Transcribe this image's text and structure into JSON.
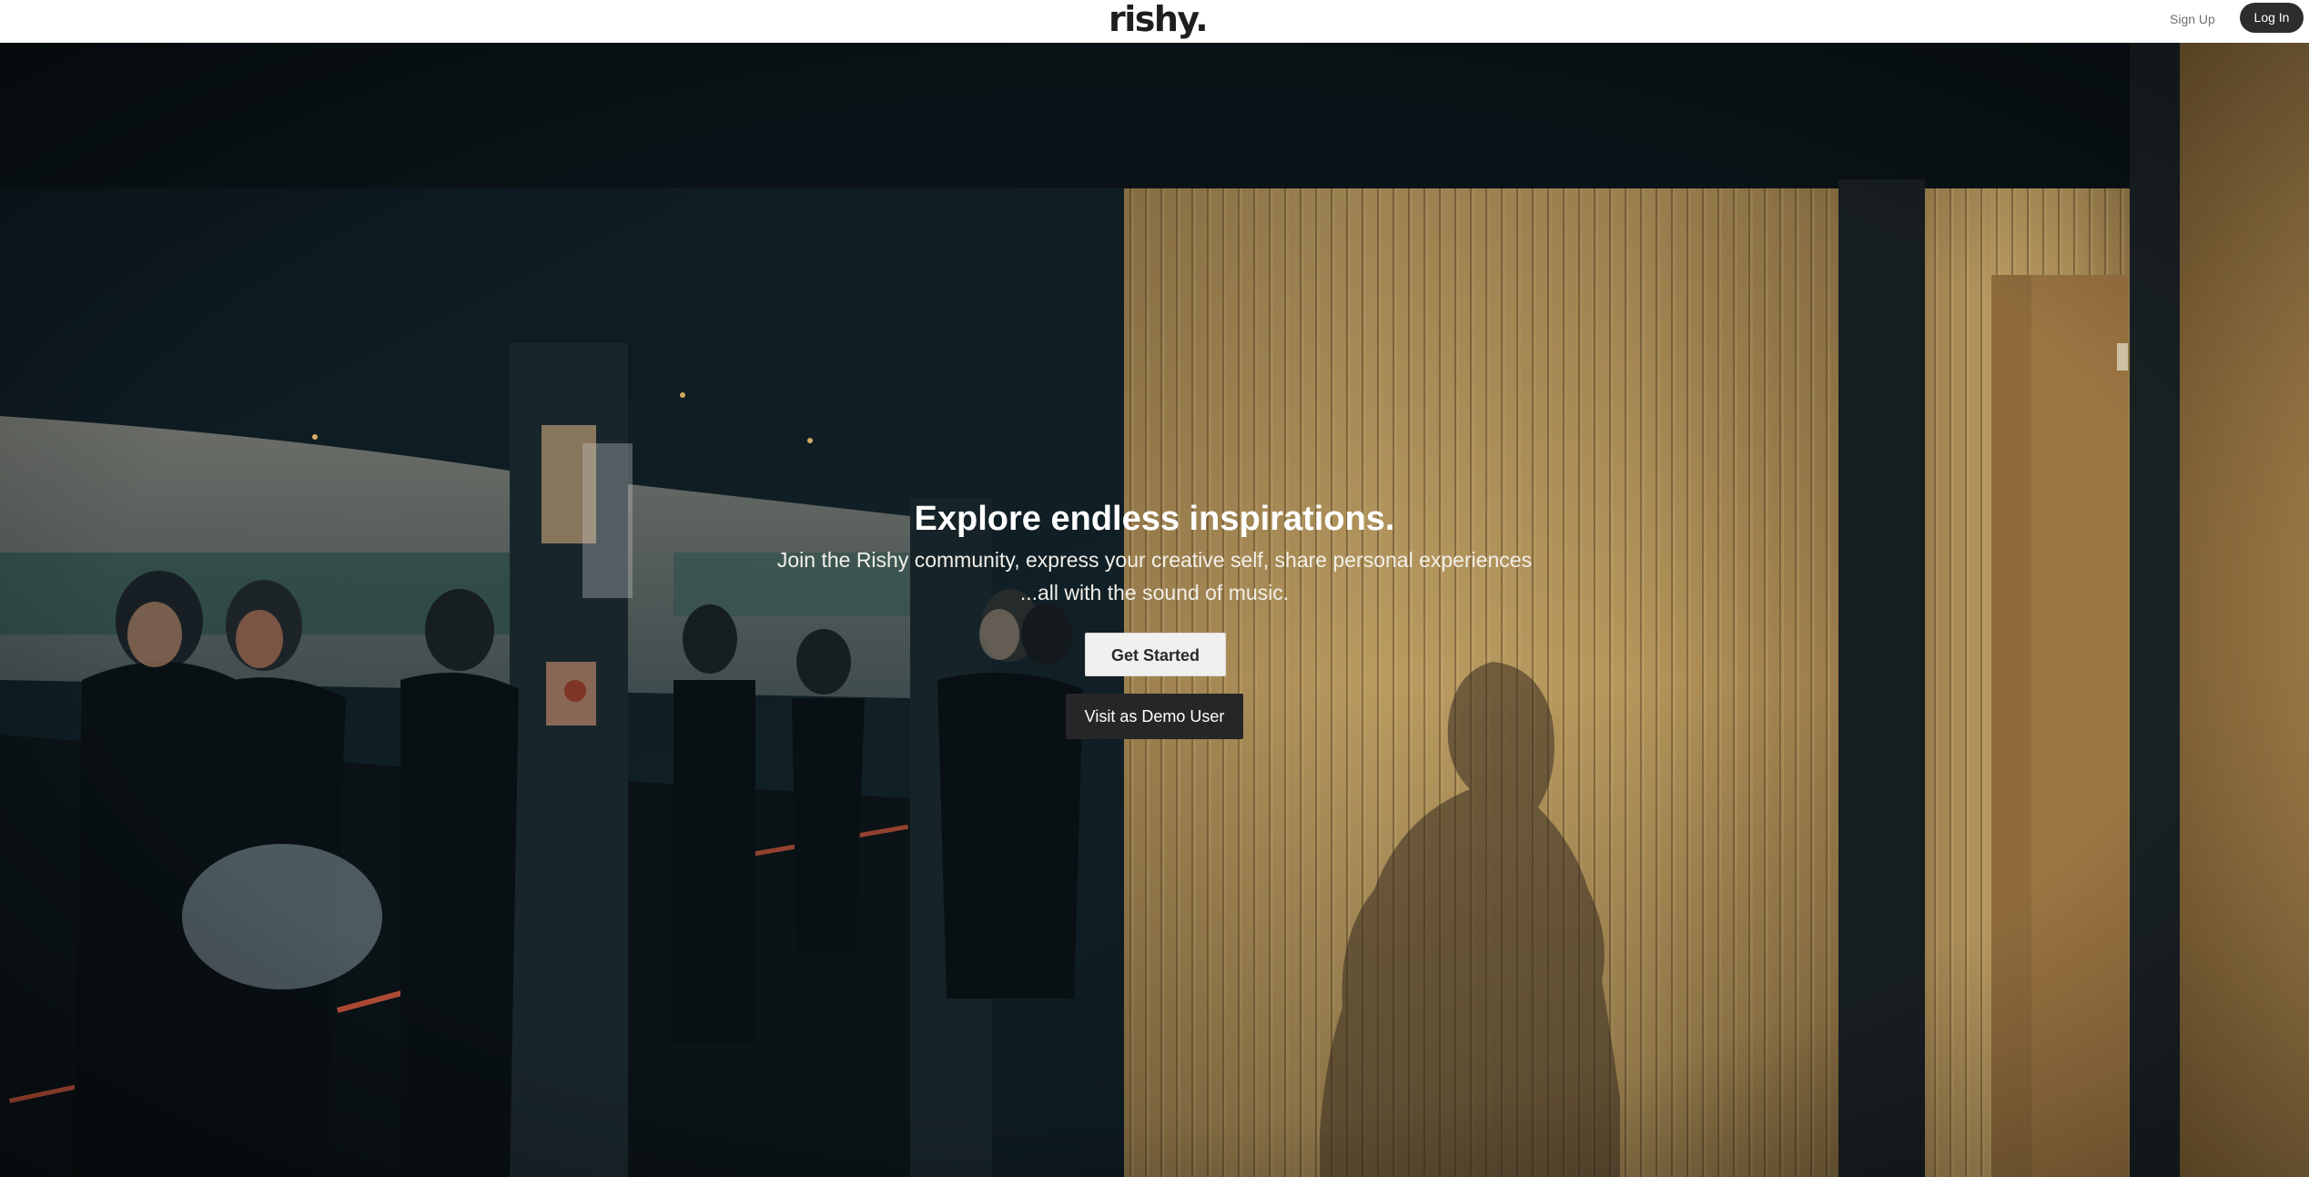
{
  "header": {
    "logo_text": "rishy.",
    "signup_label": "Sign Up",
    "login_label": "Log In"
  },
  "hero": {
    "headline": "Explore endless inspirations.",
    "subtext_line1": "Join the Rishy community, express your creative self, share personal experiences",
    "subtext_line2": "...all with the sound of music.",
    "get_started_label": "Get Started",
    "demo_label": "Visit as Demo User"
  },
  "colors": {
    "header_bg": "#ffffff",
    "login_button_bg": "#2d2d30",
    "get_started_bg": "#f0f0ee",
    "demo_button_bg": "#262628",
    "hero_text": "#ffffff"
  }
}
